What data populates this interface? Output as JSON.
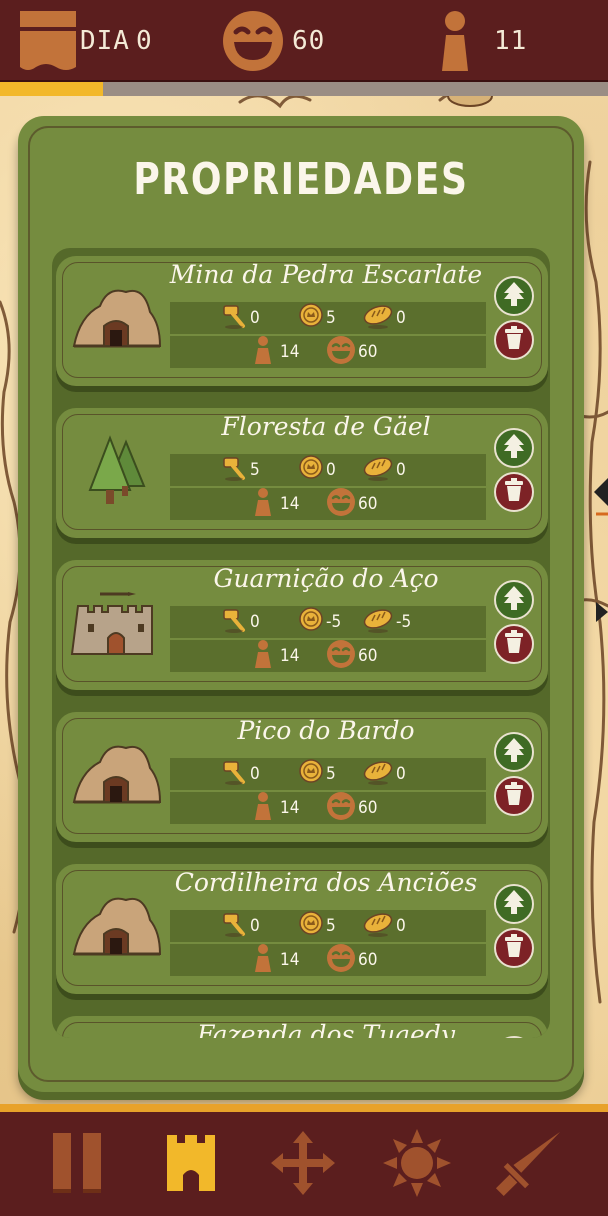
{
  "top_bar": {
    "day_label": "DIA",
    "day_value": "0",
    "happiness_value": "60",
    "population_value": "11",
    "day_progress": 0.17
  },
  "panel": {
    "title": "PROPRIEDADES"
  },
  "properties": [
    {
      "name": "Mina da Pedra Escarlate",
      "icon": "mine-icon",
      "hammer": "0",
      "coin": "5",
      "bread": "0",
      "people": "14",
      "happiness": "60"
    },
    {
      "name": "Floresta de Gäel",
      "icon": "forest-icon",
      "hammer": "5",
      "coin": "0",
      "bread": "0",
      "people": "14",
      "happiness": "60"
    },
    {
      "name": "Guarnição do Aço",
      "icon": "castle-icon",
      "hammer": "0",
      "coin": "-5",
      "bread": "-5",
      "people": "14",
      "happiness": "60"
    },
    {
      "name": "Pico do Bardo",
      "icon": "mine-icon",
      "hammer": "0",
      "coin": "5",
      "bread": "0",
      "people": "14",
      "happiness": "60"
    },
    {
      "name": "Cordilheira dos Anciões",
      "icon": "mine-icon",
      "hammer": "0",
      "coin": "5",
      "bread": "0",
      "people": "14",
      "happiness": "60"
    },
    {
      "name": "Fazenda dos Tuaedy",
      "icon": "farm-icon",
      "hammer": "",
      "coin": "",
      "bread": "",
      "people": "",
      "happiness": ""
    }
  ],
  "bottom_bar": {
    "buttons": [
      "pause-icon",
      "castle-tower-icon",
      "move-arrows-icon",
      "sun-icon",
      "sword-icon"
    ],
    "active": "castle-tower-icon"
  },
  "colors": {
    "bar": "#5b1e1e",
    "panel_green": "#758c3f",
    "accent_orange": "#c2733a",
    "accent_gold": "#f2b82a"
  }
}
